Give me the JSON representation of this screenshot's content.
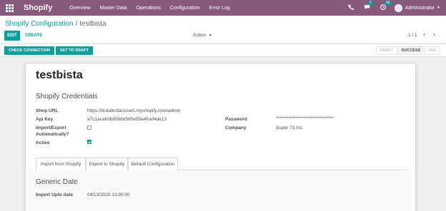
{
  "navbar": {
    "brand": "Shopify",
    "menu": [
      "Overview",
      "Master Data",
      "Operations",
      "Configuration",
      "Error Log"
    ],
    "phone_icon": "phone-icon",
    "messages_icon": "chat-icon",
    "messages_count": "1",
    "activity_icon": "clock-icon",
    "activity_count": "34",
    "user": "Administrator"
  },
  "breadcrumb": {
    "parent": "Shopify Configuration",
    "separator": "/",
    "current": "testbista"
  },
  "toolbar": {
    "edit": "EDIT",
    "create": "CREATE",
    "action": "Action",
    "pager": "1 / 1",
    "prev": "‹",
    "next": "›"
  },
  "statusbar": {
    "check_connection": "CHECK CONNECTION",
    "set_to_draft": "SET TO DRAFT",
    "stages": [
      "DRAFT",
      "SUCCESS",
      "FAIL"
    ],
    "current_stage": "SUCCESS"
  },
  "record": {
    "title": "testbista",
    "section": "Shopify Credentials",
    "shop_url_label": "Shop URL",
    "shop_url": "https://bistatestaccount.myshopify.com/admin",
    "api_key_label": "Api Key",
    "api_key": "a7c1aca60b9566d565e55a4fcef4de13",
    "import_export_label_1": "Import/Export",
    "import_export_label_2": "Automatically?",
    "import_export_checked": false,
    "active_label": "Active",
    "active_checked": true,
    "password_label": "Password",
    "password": "********************************",
    "company_label": "Company",
    "company": "Super 73 Inc."
  },
  "tabs": [
    "Import from Shopify",
    "Export to Shopify",
    "Default Configuration"
  ],
  "active_tab": "Import from Shopify",
  "tab_content": {
    "heading": "Generic Date",
    "import_upto_label": "Import Upto date",
    "import_upto_value": "04/13/2020 13:30:00"
  },
  "colors": {
    "navbar": "#875a7b",
    "primary": "#00a09d"
  }
}
